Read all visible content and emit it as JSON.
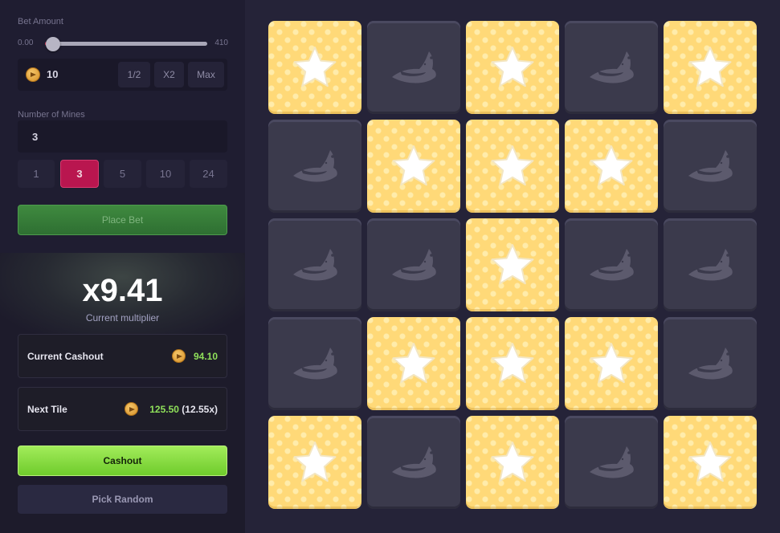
{
  "bet": {
    "label": "Bet Amount",
    "slider_min": "0.00",
    "slider_max": "410",
    "slider_fraction": 0.05,
    "amount": "10",
    "half_label": "1/2",
    "double_label": "X2",
    "max_label": "Max"
  },
  "mines": {
    "label": "Number of Mines",
    "value": "3",
    "options": [
      "1",
      "3",
      "5",
      "10",
      "24"
    ],
    "selected": "3"
  },
  "place_bet_label": "Place Bet",
  "multiplier": {
    "value": "x9.41",
    "caption": "Current multiplier"
  },
  "current_cashout": {
    "label": "Current Cashout",
    "value": "94.10"
  },
  "next_tile": {
    "label": "Next Tile",
    "value": "125.50",
    "multiplier": "(12.55x)"
  },
  "cashout_label": "Cashout",
  "pick_random_label": "Pick Random",
  "icons": {
    "coin": "coin-icon",
    "star": "star-icon",
    "witch_hat": "witch-hat-icon"
  },
  "colors": {
    "star_tile": "#ffd978",
    "hidden_tile": "#3b3a4c",
    "accent_red": "#b9164f",
    "accent_green": "#8fe05a"
  },
  "board": {
    "rows": 5,
    "cols": 5,
    "tiles": [
      [
        "star",
        "witch",
        "star",
        "witch",
        "star"
      ],
      [
        "witch",
        "star",
        "star",
        "star",
        "witch"
      ],
      [
        "witch",
        "witch",
        "star",
        "witch",
        "witch"
      ],
      [
        "witch",
        "star",
        "star",
        "star",
        "witch"
      ],
      [
        "star",
        "witch",
        "star",
        "witch",
        "star"
      ]
    ]
  }
}
